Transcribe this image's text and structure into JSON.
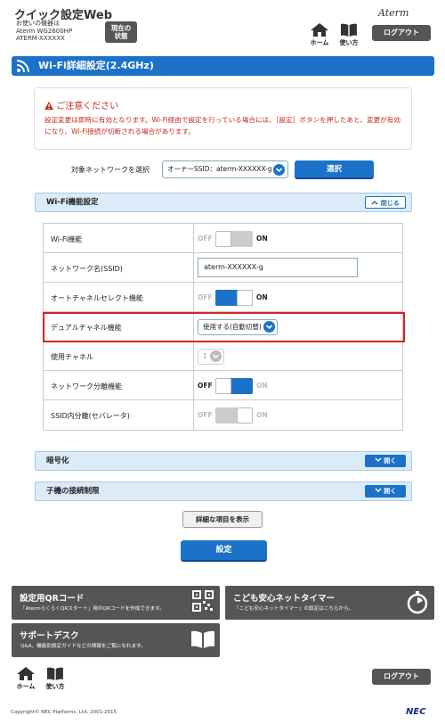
{
  "header": {
    "app_title": "クイック設定Web",
    "device_caption": "お使いの機器は",
    "device_model": "Aterm WG2600HP",
    "device_name": "ATERM-XXXXXX",
    "status_line1": "現在の",
    "status_line2": "状態",
    "brand": "Aterm",
    "home_label": "ホーム",
    "help_label": "使い方",
    "logout_label": "ログアウト"
  },
  "page_title": "Wi-Fi詳細設定(2.4GHz)",
  "notice": {
    "title": "ご注意ください",
    "body": "設定変更は即時に有効となります。Wi-Fi経由で設定を行っている場合には、［設定］ボタンを押したあと、変更が有効になり、Wi-Fi接続が切断される場合があります。"
  },
  "network_select": {
    "label": "対象ネットワークを選択",
    "value": "オーナーSSID：aterm-XXXXXX-g",
    "button": "選択"
  },
  "wifi_section": {
    "title": "Wi-Fi機能設定",
    "toggle": "閉じる",
    "rows": [
      {
        "label": "Wi-Fi機能",
        "off": "OFF",
        "on": "ON"
      },
      {
        "label": "ネットワーク名(SSID)",
        "value": "aterm-XXXXXX-g"
      },
      {
        "label": "オートチャネルセレクト機能",
        "off": "OFF",
        "on": "ON"
      },
      {
        "label": "デュアルチャネル機能",
        "value": "使用する(自動切替)"
      },
      {
        "label": "使用チャネル",
        "value": "1"
      },
      {
        "label": "ネットワーク分離機能",
        "off": "OFF",
        "on": "ON"
      },
      {
        "label": "SSID内分離(セパレータ)",
        "off": "OFF",
        "on": "ON"
      }
    ]
  },
  "encryption_section": {
    "title": "暗号化",
    "toggle": "開く"
  },
  "restriction_section": {
    "title": "子機の接続制限",
    "toggle": "開く"
  },
  "detail_button": "詳細な項目を表示",
  "apply_button": "設定",
  "tiles": {
    "qr_title": "設定用QRコード",
    "qr_desc": "「AtermらくらくQRスタート」用のQRコードを作成できます。",
    "timer_title": "こども安心ネットタイマー",
    "timer_desc": "「こども安心ネットタイマー」の設定はこちらから。",
    "support_title": "サポートデスク",
    "support_desc": "Q&A、機能別設定ガイドなどの情報をご覧になれます。"
  },
  "footer": {
    "home_label": "ホーム",
    "help_label": "使い方",
    "logout_label": "ログアウト",
    "copyright": "Copyright© NEC Platforms, Ltd. 2001-2015",
    "logo": "NEC"
  },
  "colors": {
    "accent": "#1b72c8",
    "warning": "#c8281c",
    "dark_button": "#555555",
    "highlight": "#d2232a"
  }
}
